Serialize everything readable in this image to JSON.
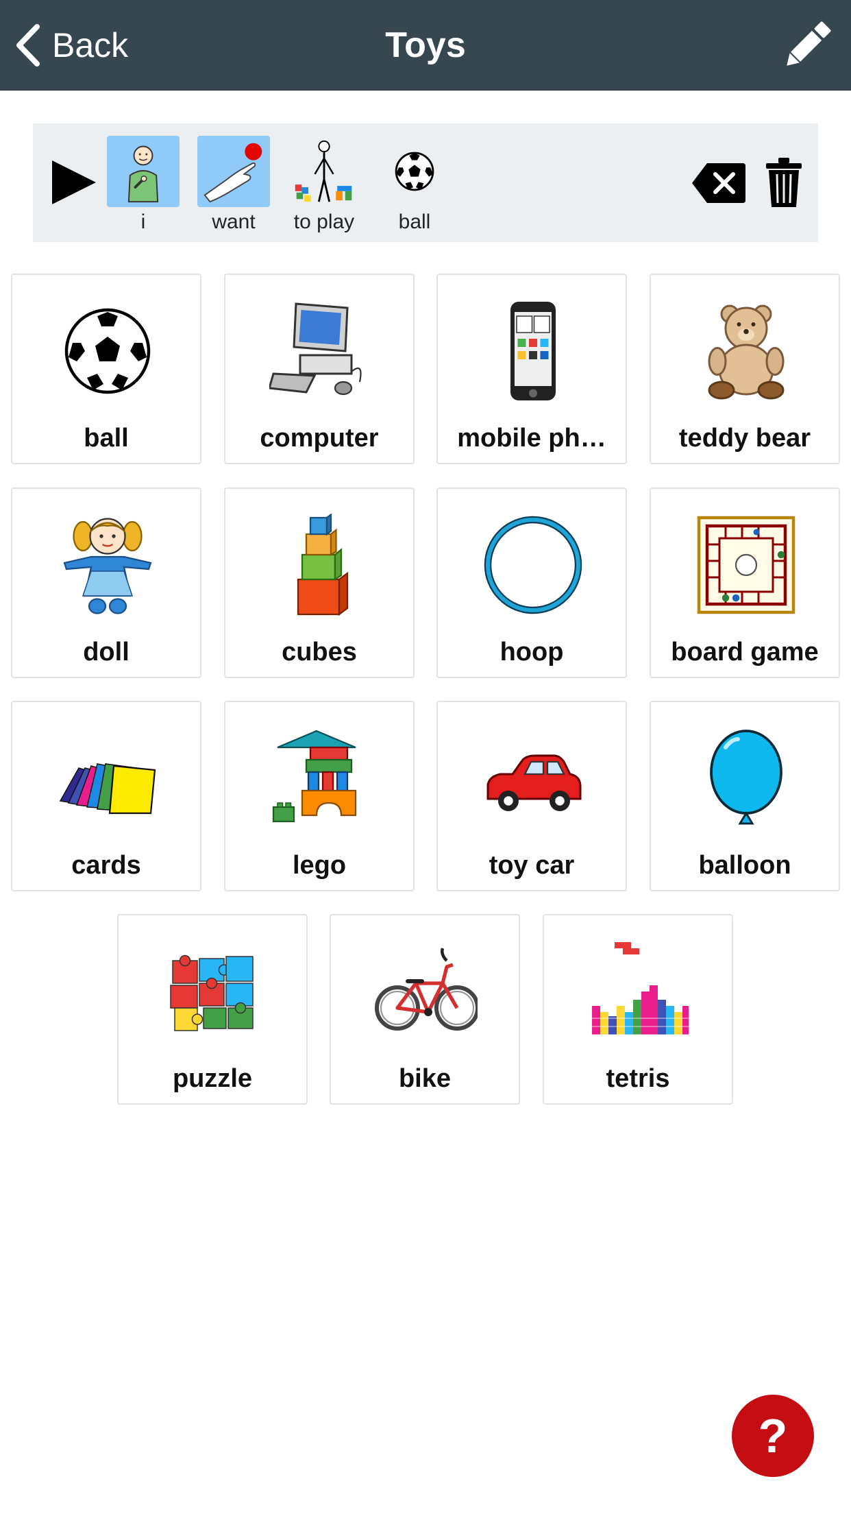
{
  "header": {
    "back_label": "Back",
    "title": "Toys"
  },
  "sentence": {
    "words": [
      {
        "label": "i",
        "icon": "person-pointing-self-icon",
        "highlighted": true
      },
      {
        "label": "want",
        "icon": "hand-reaching-icon",
        "highlighted": true
      },
      {
        "label": "to play",
        "icon": "person-playing-blocks-icon",
        "highlighted": false
      },
      {
        "label": "ball",
        "icon": "soccer-ball-icon",
        "highlighted": false
      }
    ]
  },
  "tiles": [
    {
      "label": "ball",
      "icon": "soccer-ball-icon"
    },
    {
      "label": "computer",
      "icon": "desktop-computer-icon"
    },
    {
      "label": "mobile ph…",
      "icon": "mobile-phone-icon"
    },
    {
      "label": "teddy bear",
      "icon": "teddy-bear-icon"
    },
    {
      "label": "doll",
      "icon": "doll-icon"
    },
    {
      "label": "cubes",
      "icon": "stacked-cubes-icon"
    },
    {
      "label": "hoop",
      "icon": "hoop-icon"
    },
    {
      "label": "board game",
      "icon": "board-game-icon"
    },
    {
      "label": "cards",
      "icon": "playing-cards-icon"
    },
    {
      "label": "lego",
      "icon": "lego-blocks-icon"
    },
    {
      "label": "toy car",
      "icon": "toy-car-icon"
    },
    {
      "label": "balloon",
      "icon": "balloon-icon"
    },
    {
      "label": "puzzle",
      "icon": "puzzle-icon"
    },
    {
      "label": "bike",
      "icon": "bicycle-icon"
    },
    {
      "label": "tetris",
      "icon": "tetris-icon"
    }
  ],
  "help": {
    "label": "?"
  },
  "colors": {
    "header_bg": "#37474f",
    "sentence_bar_bg": "#eceff1",
    "word_highlight": "#90caf9",
    "help_button": "#c40d12"
  }
}
